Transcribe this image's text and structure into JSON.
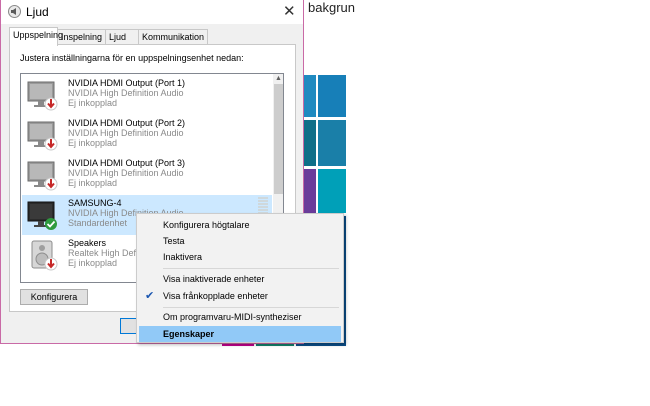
{
  "background": {
    "partial_text": "bakgrun",
    "tile_colors": {
      "magenta": "#c0008c",
      "blue1": "#1f8ac0",
      "blue2": "#177fb8",
      "teal": "#00a0b8",
      "purple": "#6a3d9a",
      "darkteal": "#0f6f88",
      "deepblue": "#0b4f8a",
      "green": "#12806a"
    }
  },
  "window": {
    "title": "Ljud",
    "title_icon": "speaker-icon",
    "close_glyph": "✕",
    "border_color": "#c96aa6"
  },
  "tabs": [
    {
      "label": "Uppspelning",
      "active": true
    },
    {
      "label": "Inspelning",
      "active": false
    },
    {
      "label": "Ljud",
      "active": false
    },
    {
      "label": "Kommunikation",
      "active": false
    }
  ],
  "panel": {
    "instruction": "Justera inställningarna för en uppspelningsenhet nedan:"
  },
  "devices": [
    {
      "name": "NVIDIA HDMI Output (Port 1)",
      "driver": "NVIDIA High Definition Audio",
      "status": "Ej inkopplad",
      "icon": "monitor-disconnected-icon",
      "selected": false
    },
    {
      "name": "NVIDIA HDMI Output (Port 2)",
      "driver": "NVIDIA High Definition Audio",
      "status": "Ej inkopplad",
      "icon": "monitor-disconnected-icon",
      "selected": false
    },
    {
      "name": "NVIDIA HDMI Output (Port 3)",
      "driver": "NVIDIA High Definition Audio",
      "status": "Ej inkopplad",
      "icon": "monitor-disconnected-icon",
      "selected": false
    },
    {
      "name": "SAMSUNG-4",
      "driver": "NVIDIA High Definition Audio",
      "status": "Standardenhet",
      "icon": "monitor-default-icon",
      "selected": true
    },
    {
      "name": "Speakers",
      "driver": "Realtek High Definition Audio",
      "status": "Ej inkopplad",
      "icon": "speaker-disconnected-icon",
      "selected": false
    }
  ],
  "buttons": {
    "configure": "Konfigurera"
  },
  "context_menu": {
    "items": [
      {
        "label": "Konfigurera högtalare",
        "checked": false,
        "highlighted": false
      },
      {
        "label": "Testa",
        "checked": false,
        "highlighted": false
      },
      {
        "label": "Inaktivera",
        "checked": false,
        "highlighted": false
      },
      {
        "label": "Visa inaktiverade enheter",
        "checked": false,
        "highlighted": false
      },
      {
        "label": "Visa frånkopplade enheter",
        "checked": true,
        "highlighted": false
      },
      {
        "label": "Om programvaru-MIDI-syntheziser",
        "checked": false,
        "highlighted": false
      },
      {
        "label": "Egenskaper",
        "checked": false,
        "highlighted": true
      }
    ],
    "check_glyph": "✔"
  }
}
